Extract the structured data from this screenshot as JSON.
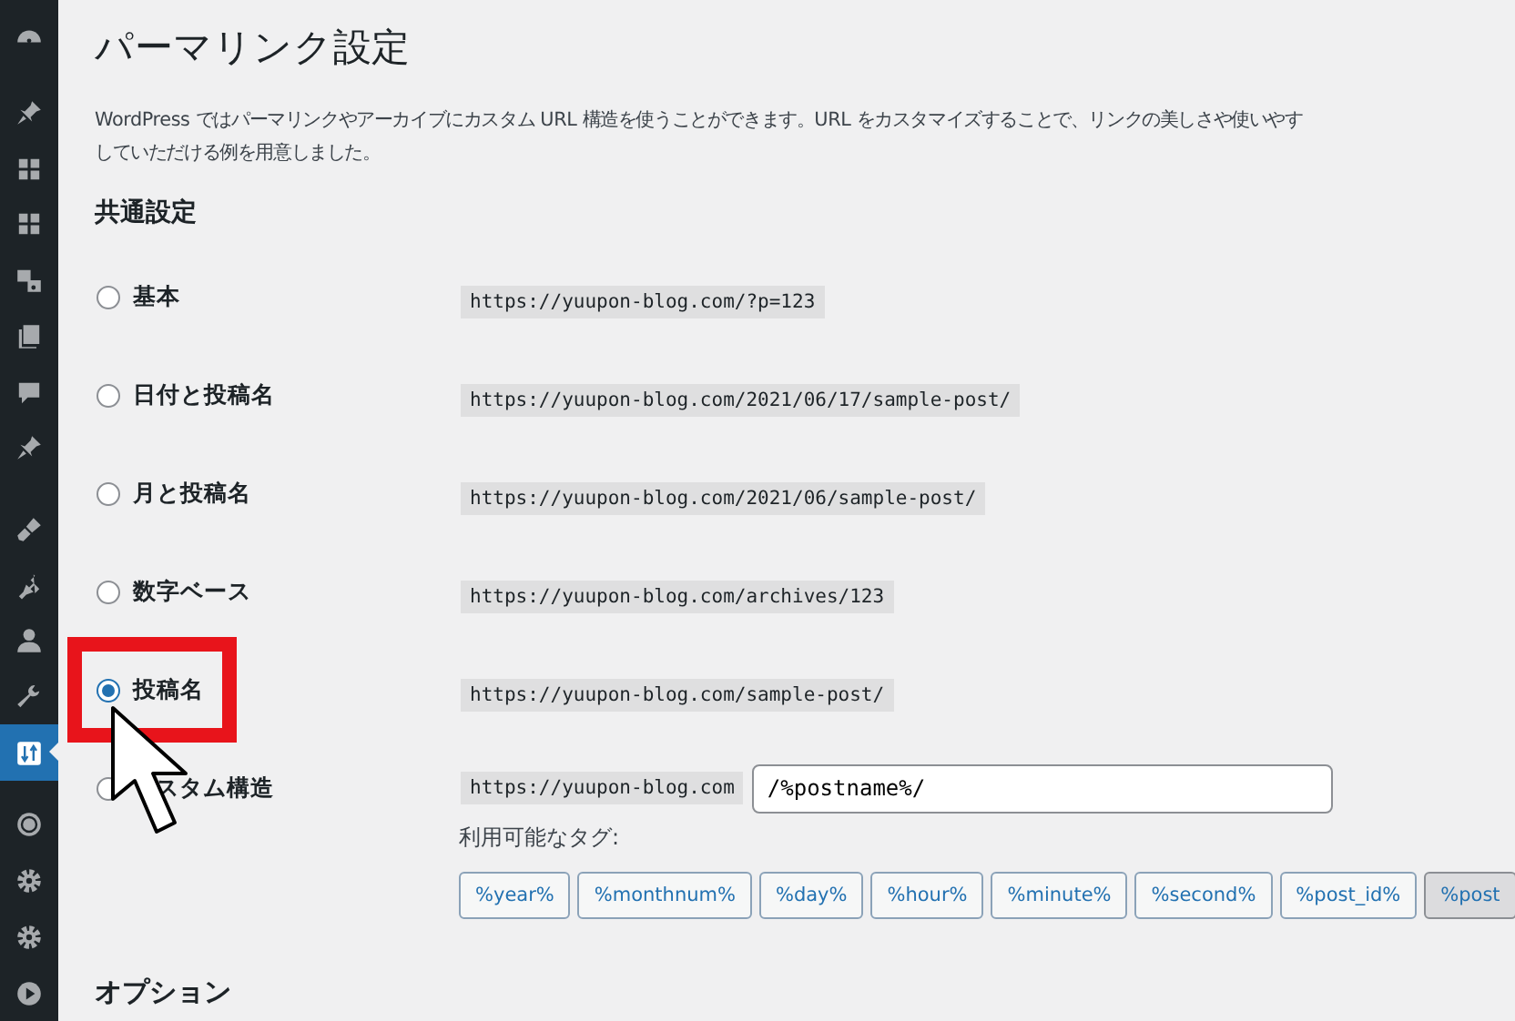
{
  "sidebar": {
    "items": [
      {
        "kind": "gauge",
        "selected": false
      },
      {
        "kind": "pin",
        "selected": false
      },
      {
        "kind": "grid",
        "selected": false
      },
      {
        "kind": "grid",
        "selected": false
      },
      {
        "kind": "media",
        "selected": false
      },
      {
        "kind": "pages",
        "selected": false
      },
      {
        "kind": "comment",
        "selected": false
      },
      {
        "kind": "pin",
        "selected": false
      },
      {
        "kind": "brush",
        "selected": false
      },
      {
        "kind": "plug",
        "selected": false
      },
      {
        "kind": "user",
        "selected": false
      },
      {
        "kind": "wrench",
        "selected": false
      },
      {
        "kind": "sliders",
        "selected": true
      },
      {
        "kind": "circle",
        "selected": false
      },
      {
        "kind": "gear",
        "selected": false
      },
      {
        "kind": "gear",
        "selected": false
      },
      {
        "kind": "play",
        "selected": false
      }
    ]
  },
  "title": "パーマリンク設定",
  "description": [
    "WordPress ではパーマリンクやアーカイブにカスタム URL 構造を使うことができます。URL をカスタマイズすることで、リンクの美しさや使いやす",
    "していただける例を用意しました。"
  ],
  "section": "共通設定",
  "options": [
    {
      "label": "基本",
      "url": "https://yuupon-blog.com/?p=123",
      "selected": false
    },
    {
      "label": "日付と投稿名",
      "url": "https://yuupon-blog.com/2021/06/17/sample-post/",
      "selected": false
    },
    {
      "label": "月と投稿名",
      "url": "https://yuupon-blog.com/2021/06/sample-post/",
      "selected": false
    },
    {
      "label": "数字ベース",
      "url": "https://yuupon-blog.com/archives/123",
      "selected": false
    },
    {
      "label": "投稿名",
      "url": "https://yuupon-blog.com/sample-post/",
      "selected": true
    },
    {
      "label": "スタム構造",
      "url": "https://yuupon-blog.com",
      "selected": false
    }
  ],
  "custom_structure": {
    "value": "/%postname%/",
    "tags_label": "利用可能なタグ:",
    "tags": [
      {
        "label": "%year%",
        "selected": false
      },
      {
        "label": "%monthnum%",
        "selected": false
      },
      {
        "label": "%day%",
        "selected": false
      },
      {
        "label": "%hour%",
        "selected": false
      },
      {
        "label": "%minute%",
        "selected": false
      },
      {
        "label": "%second%",
        "selected": false
      },
      {
        "label": "%post_id%",
        "selected": false
      },
      {
        "label": "%post",
        "selected": true
      }
    ]
  },
  "next_section": "オプション"
}
